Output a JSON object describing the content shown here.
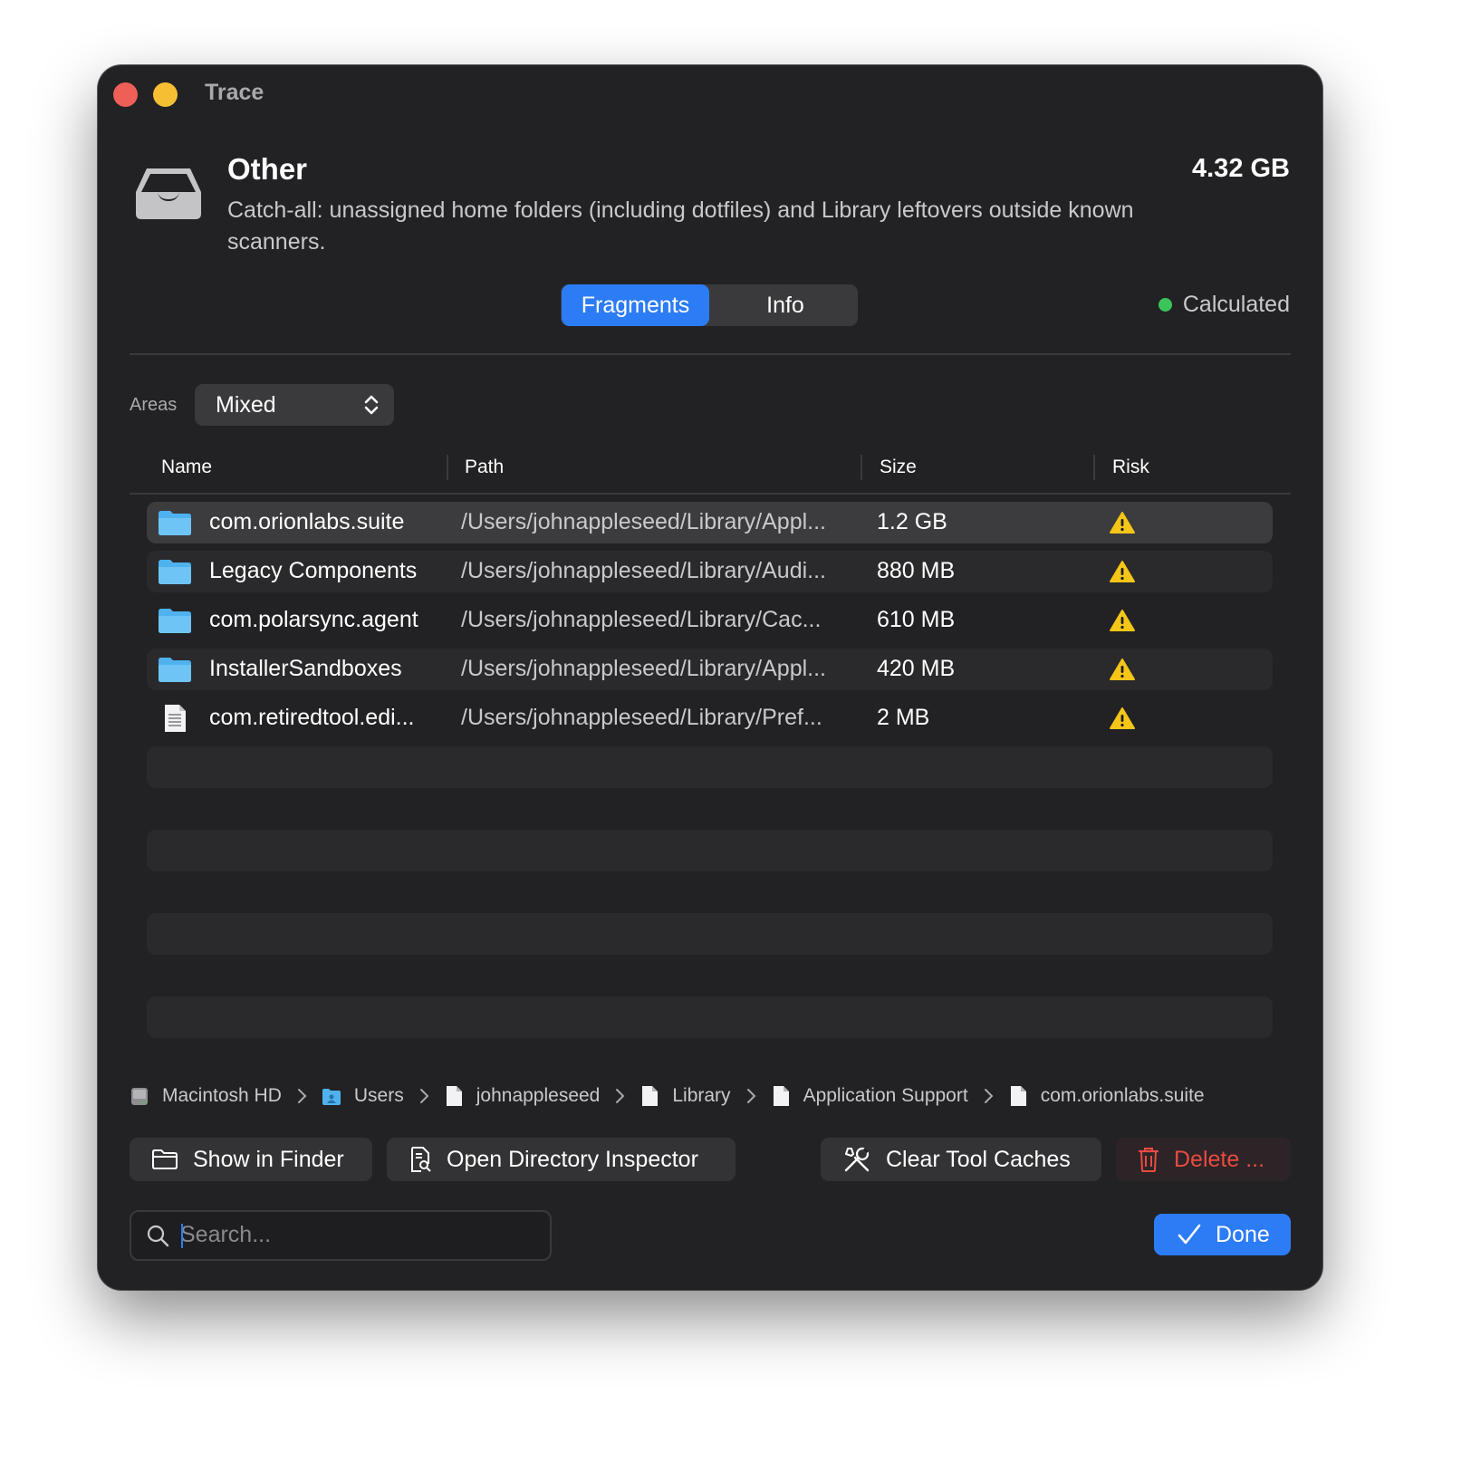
{
  "window": {
    "title": "Trace"
  },
  "category": {
    "title": "Other",
    "description": "Catch-all: unassigned home folders (including dotfiles) and Library leftovers outside known scanners.",
    "size": "4.32 GB",
    "icon": "tray-icon"
  },
  "tabs": [
    {
      "label": "Fragments",
      "active": true
    },
    {
      "label": "Info",
      "active": false
    }
  ],
  "status": {
    "label": "Calculated",
    "color": "#3cc35a"
  },
  "areas": {
    "label": "Areas",
    "value": "Mixed"
  },
  "table": {
    "columns": [
      "Name",
      "Path",
      "Size",
      "Risk"
    ],
    "rows": [
      {
        "icon": "folder-icon",
        "name": "com.orionlabs.suite",
        "path": "/Users/johnappleseed/Library/Appl...",
        "size": "1.2 GB",
        "risk": "warning-icon",
        "selected": true
      },
      {
        "icon": "folder-icon",
        "name": "Legacy Components",
        "path": "/Users/johnappleseed/Library/Audi...",
        "size": "880 MB",
        "risk": "warning-icon"
      },
      {
        "icon": "folder-icon",
        "name": "com.polarsync.agent",
        "path": "/Users/johnappleseed/Library/Cac...",
        "size": "610 MB",
        "risk": "warning-icon"
      },
      {
        "icon": "folder-icon",
        "name": "InstallerSandboxes",
        "path": "/Users/johnappleseed/Library/Appl...",
        "size": "420 MB",
        "risk": "warning-icon"
      },
      {
        "icon": "document-icon",
        "name": "com.retiredtool.edi...",
        "path": "/Users/johnappleseed/Library/Pref...",
        "size": "2 MB",
        "risk": "warning-icon"
      }
    ]
  },
  "breadcrumb": [
    {
      "icon": "disk-icon",
      "label": "Macintosh HD"
    },
    {
      "icon": "folder-icon",
      "label": "Users"
    },
    {
      "icon": "document-icon",
      "label": "johnappleseed"
    },
    {
      "icon": "document-icon",
      "label": "Library"
    },
    {
      "icon": "document-icon",
      "label": "Application Support"
    },
    {
      "icon": "document-icon",
      "label": "com.orionlabs.suite"
    }
  ],
  "actions": {
    "show_in_finder": "Show in Finder",
    "open_inspector": "Open Directory Inspector",
    "clear_caches": "Clear Tool Caches",
    "delete": "Delete ..."
  },
  "search": {
    "placeholder": "Search...",
    "value": ""
  },
  "done": "Done",
  "colors": {
    "accent": "#2c7cf6",
    "danger": "#ea4a42",
    "warning": "#f5c518",
    "background": "#222224"
  }
}
